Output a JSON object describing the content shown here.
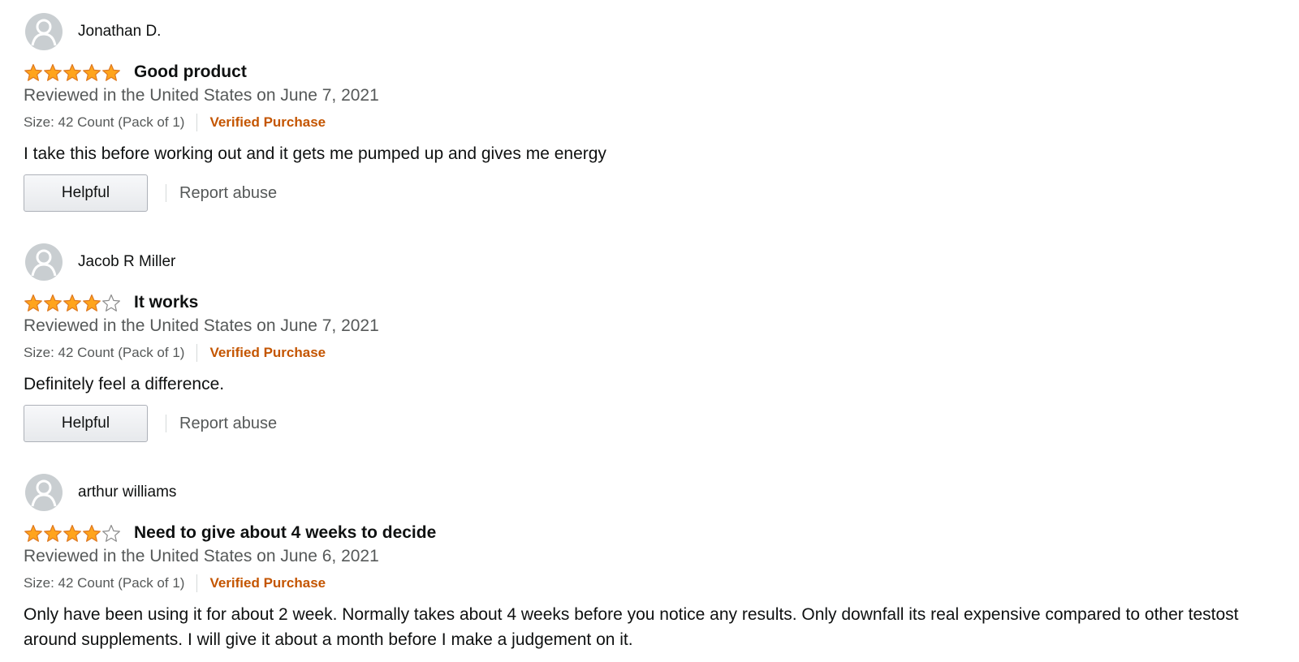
{
  "reviews": [
    {
      "name": "Jonathan D.",
      "rating": 5,
      "title": "Good product",
      "date": "Reviewed in the United States on June 7, 2021",
      "variant": "Size: 42 Count (Pack of 1)",
      "verified": "Verified Purchase",
      "body": "I take this before working out and it gets me pumped up and gives me energy",
      "helpful_label": "Helpful",
      "report_label": "Report abuse"
    },
    {
      "name": "Jacob R Miller",
      "rating": 4,
      "title": "It works",
      "date": "Reviewed in the United States on June 7, 2021",
      "variant": "Size: 42 Count (Pack of 1)",
      "verified": "Verified Purchase",
      "body": "Definitely feel a difference.",
      "helpful_label": "Helpful",
      "report_label": "Report abuse"
    },
    {
      "name": "arthur williams",
      "rating": 4,
      "title": "Need to give about 4 weeks to decide",
      "date": "Reviewed in the United States on June 6, 2021",
      "variant": "Size: 42 Count (Pack of 1)",
      "verified": "Verified Purchase",
      "body": "Only have been using it for about 2 week. Normally takes about 4 weeks before you notice any results. Only downfall its real expensive compared to other testost around supplements. I will give it about a month before I make a judgement on it."
    }
  ],
  "colors": {
    "star_fill": "#ffa41c",
    "star_stroke": "#de7921",
    "verified": "#c45500",
    "secondary_text": "#565959"
  },
  "icons": {
    "avatar": "default-profile-avatar-icon",
    "star_full": "star-filled-icon",
    "star_empty": "star-empty-icon"
  }
}
